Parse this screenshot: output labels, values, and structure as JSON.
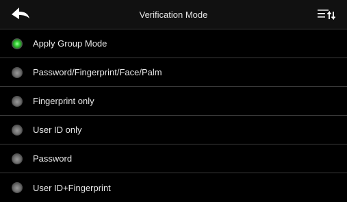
{
  "header": {
    "title": "Verification Mode",
    "back_icon": "back-arrow-icon",
    "menu_icon": "sort-menu-icon"
  },
  "options": [
    {
      "label": "Apply Group Mode",
      "selected": true
    },
    {
      "label": "Password/Fingerprint/Face/Palm",
      "selected": false
    },
    {
      "label": "Fingerprint only",
      "selected": false
    },
    {
      "label": "User ID only",
      "selected": false
    },
    {
      "label": "Password",
      "selected": false
    },
    {
      "label": "User ID+Fingerprint",
      "selected": false
    }
  ],
  "colors": {
    "background": "#000000",
    "selected_radio": "#35d135",
    "divider": "#3c3c3c"
  }
}
